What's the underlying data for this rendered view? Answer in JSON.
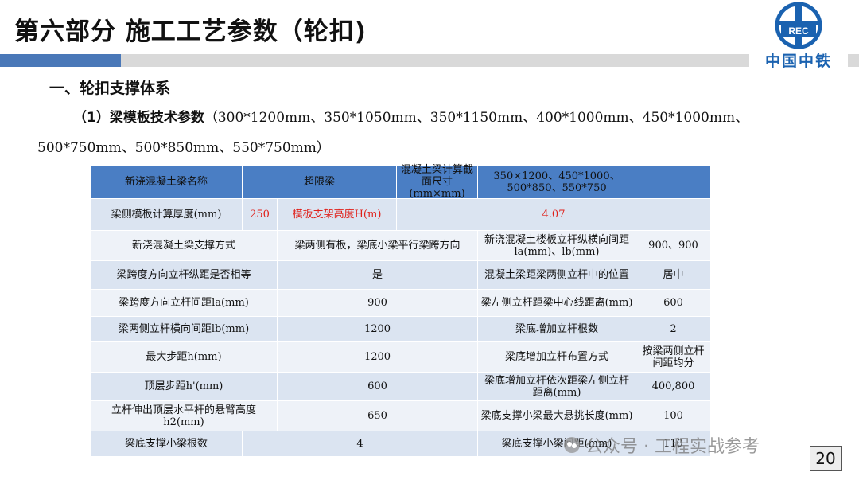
{
  "header": {
    "title": "第六部分  施工工艺参数（轮扣)",
    "logo_text": "中国中铁",
    "logo_mark": "REC"
  },
  "section": {
    "heading": "一、轮扣支撑体系",
    "sub_lead": "（1）梁模板技术参数",
    "sub_line1": "（300*1200mm、350*1050mm、350*1150mm、400*1000mm、450*1000mm、",
    "sub_line2": "500*750mm、500*850mm、550*750mm）"
  },
  "table": {
    "r1": {
      "c1": "新浇混凝土梁名称",
      "c2": "超限梁",
      "c3": "混凝土梁计算截面尺寸(mm×mm)",
      "c4": "350×1200、450*1000、500*850、550*750",
      "c5": ""
    },
    "r2": {
      "c1": "梁侧模板计算厚度(mm)",
      "c2": "250",
      "c3": "模板支架高度H(m)",
      "c4": "4.07"
    },
    "r3": {
      "c1": "新浇混凝土梁支撑方式",
      "c2": "梁两侧有板，梁底小梁平行梁跨方向",
      "c3a": "新浇混凝土楼板立杆纵横向间距",
      "c3b": "la(mm)、lb(mm)",
      "c4": "900、900"
    },
    "r4": {
      "c1": "梁跨度方向立杆纵距是否相等",
      "c2": "是",
      "c3": "混凝土梁距梁两侧立杆中的位置",
      "c4": "居中"
    },
    "r5": {
      "c1": "梁跨度方向立杆间距la(mm)",
      "c2": "900",
      "c3": "梁左侧立杆距梁中心线距离(mm)",
      "c4": "600"
    },
    "r6": {
      "c1": "梁两侧立杆横向间距lb(mm)",
      "c2": "1200",
      "c3": "梁底增加立杆根数",
      "c4": "2"
    },
    "r7": {
      "c1": "最大步距h(mm)",
      "c2": "1200",
      "c3": "梁底增加立杆布置方式",
      "c4": "按梁两侧立杆间距均分"
    },
    "r8": {
      "c1": "顶层步距h'(mm)",
      "c2": "600",
      "c3": "梁底增加立杆依次距梁左侧立杆距离(mm)",
      "c4": "400,800"
    },
    "r9": {
      "c1": "立杆伸出顶层水平杆的悬臂高度h2(mm)",
      "c2": "650",
      "c3": "梁底支撑小梁最大悬挑长度(mm)",
      "c4": "100"
    },
    "r10": {
      "c1": "梁底支撑小梁根数",
      "c2": "4",
      "c3": "梁底支撑小梁间距(mm)",
      "c4": "110"
    }
  },
  "watermark": {
    "text": "公众号 · 工程实战参考"
  },
  "page_number": "20",
  "colors": {
    "accent_blue": "#4a78b8",
    "header_row": "#4a7ec4",
    "row_a": "#dbe4f1",
    "row_b": "#eef2f8",
    "highlight_red": "#e0201a",
    "logo_blue": "#1a62b0"
  }
}
